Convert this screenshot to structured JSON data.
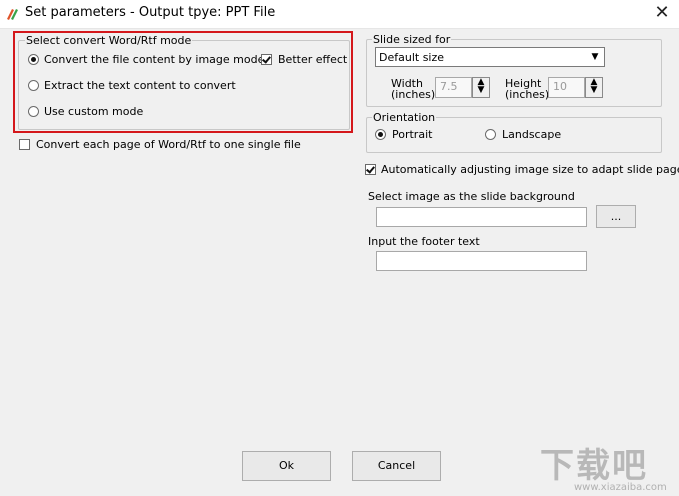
{
  "window": {
    "title": "Set parameters - Output tpye: PPT File",
    "close_glyph": "✕",
    "icon": "app-logo-icon"
  },
  "mode_group": {
    "label": "Select convert Word/Rtf mode",
    "options": [
      {
        "label": "Convert the file content by image mode",
        "selected": true
      },
      {
        "label": "Extract the text content to convert",
        "selected": false
      },
      {
        "label": "Use custom mode",
        "selected": false
      }
    ],
    "better_effect": {
      "label": "Better effect",
      "checked": true
    }
  },
  "single_file": {
    "label": "Convert each page of Word/Rtf to one single file",
    "checked": false
  },
  "slide_size": {
    "label": "Slide sized for",
    "selected": "Default size",
    "width_label_1": "Width",
    "width_label_2": "(inches)",
    "width_value": "7.5",
    "height_label_1": "Height",
    "height_label_2": "(inches)",
    "height_value": "10"
  },
  "orientation": {
    "label": "Orientation",
    "options": [
      {
        "label": "Portrait",
        "selected": true
      },
      {
        "label": "Landscape",
        "selected": false
      }
    ]
  },
  "auto_adjust": {
    "label": "Automatically adjusting image size to adapt slide page",
    "checked": true
  },
  "background": {
    "label": "Select image as the slide background",
    "value": "",
    "browse_label": "..."
  },
  "footer": {
    "label": "Input the footer text",
    "value": ""
  },
  "buttons": {
    "ok": "Ok",
    "cancel": "Cancel"
  },
  "watermark": {
    "text": "下载吧",
    "url": "www.xiazaiba.com"
  },
  "colors": {
    "highlight": "#d4171b",
    "background": "#f0f0f0"
  }
}
